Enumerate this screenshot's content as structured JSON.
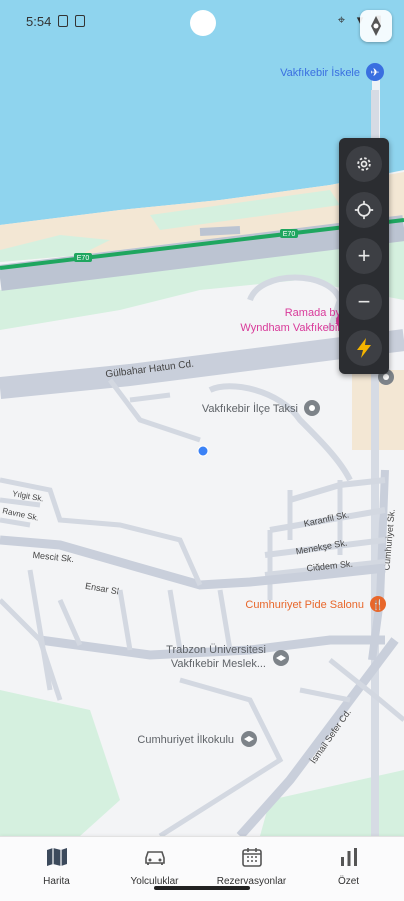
{
  "status_bar": {
    "time": "5:54"
  },
  "map": {
    "colors": {
      "sea": "#8fd4ee",
      "land": "#f3f4f6",
      "green": "#d5f0df",
      "sand": "#f3e7d4",
      "road": "#bcc4d2",
      "highway_line": "#1fa65f"
    },
    "places": [
      {
        "name": "Vakfıkebir İskele",
        "color": "#3a6fe0",
        "icon": "airplane-icon"
      },
      {
        "name": "Ramada by",
        "color": "#d93a9a"
      },
      {
        "name": "Wyndham Vakfıkebir",
        "color": "#d93a9a",
        "icon": "hotel-icon"
      },
      {
        "name": "Vakfıkebir İlçe Taksi",
        "color": "#5f6368",
        "icon": "place-icon"
      },
      {
        "name": "Cumhuriyet Pide Salonu",
        "color": "#e8672b",
        "icon": "restaurant-icon"
      },
      {
        "name": "Trabzon Üniversitesi",
        "color": "#5f6368"
      },
      {
        "name": "Vakfıkebir Meslek...",
        "color": "#5f6368",
        "icon": "school-icon"
      },
      {
        "name": "Cumhuriyet İlkokulu",
        "color": "#5f6368",
        "icon": "school-icon"
      }
    ],
    "roads": [
      {
        "name": "E70"
      },
      {
        "name": "E70"
      },
      {
        "name": "Gülbahar Hatun Cd."
      },
      {
        "name": "Karanfil Sk."
      },
      {
        "name": "Menekşe Sk."
      },
      {
        "name": "Çiğdem Sk."
      },
      {
        "name": "Cumhuriyet Sk."
      },
      {
        "name": "Mescit Sk."
      },
      {
        "name": "Ensar Sk."
      },
      {
        "name": "İsmail Sefer Cd."
      },
      {
        "name": "Yılgit Sk."
      },
      {
        "name": "Ravne Sk."
      }
    ]
  },
  "controls": [
    {
      "name": "settings",
      "icon": "gear-icon"
    },
    {
      "name": "locate",
      "icon": "crosshair-icon"
    },
    {
      "name": "zoom-in",
      "icon": "plus-icon",
      "symbol": "+"
    },
    {
      "name": "zoom-out",
      "icon": "minus-icon",
      "symbol": "−"
    },
    {
      "name": "quick-action",
      "icon": "lightning-icon",
      "color": "#f4b400"
    }
  ],
  "bottom_nav": {
    "items": [
      {
        "label": "Harita",
        "icon": "map-icon"
      },
      {
        "label": "Yolculuklar",
        "icon": "car-icon"
      },
      {
        "label": "Rezervasyonlar",
        "icon": "calendar-icon"
      },
      {
        "label": "Özet",
        "icon": "bar-chart-icon"
      }
    ]
  }
}
